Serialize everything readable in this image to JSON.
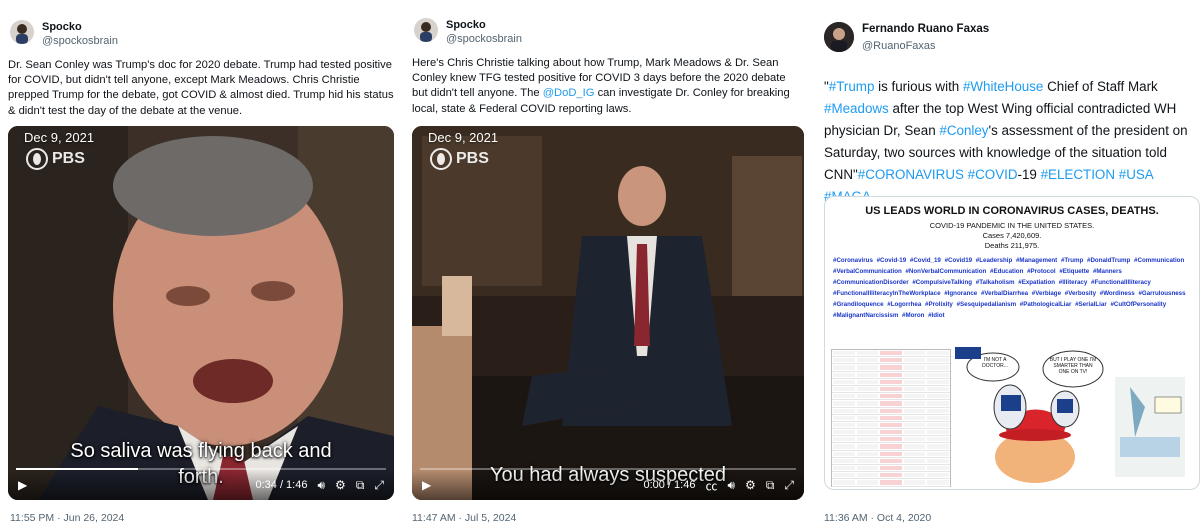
{
  "tweets": [
    {
      "author": "Spocko",
      "handle": "@spockosbrain",
      "text": "Dr. Sean Conley was Trump's doc for 2020 debate. Trump had tested positive for COVID, but didn't tell anyone, except Mark Meadows. Chris Christie prepped Trump for the debate, got COVID & almost died. Trump hid his status & didn't test the day of the debate at the venue.",
      "video": {
        "date_overlay": "Dec 9, 2021",
        "network": "PBS",
        "caption_line1": "So saliva was flying back and",
        "caption_line2": "forth.",
        "time": "0:34 / 1:46",
        "progress": 0.33
      },
      "timestamp": "11:55 PM · Jun 26, 2024"
    },
    {
      "author": "Spocko",
      "handle": "@spockosbrain",
      "text_before_link": "Here's Chris Christie talking about how Trump, Mark Meadows & Dr. Sean Conley knew TFG tested positive for COVID 3 days before the 2020 debate but didn't tell anyone. The ",
      "link": "@DoD_IG",
      "text_after_link": " can investigate Dr. Conley for breaking local, state & Federal COVID reporting laws.",
      "video": {
        "date_overlay": "Dec 9, 2021",
        "network": "PBS",
        "caption_line1": "You had always suspected",
        "time": "0:00 / 1:46",
        "progress": 0.0
      },
      "timestamp": "11:47 AM · Jul 5, 2024"
    },
    {
      "author": "Fernando Ruano Faxas",
      "handle": "@RuanoFaxas",
      "text_parts": [
        {
          "t": "\"",
          "hash": false
        },
        {
          "t": "#Trump",
          "hash": true
        },
        {
          "t": " is furious with ",
          "hash": false
        },
        {
          "t": "#WhiteHouse",
          "hash": true
        },
        {
          "t": " Chief of Staff Mark ",
          "hash": false
        },
        {
          "t": "#Meadows",
          "hash": true
        },
        {
          "t": " after the top West Wing official contradicted WH physician Dr, Sean ",
          "hash": false
        },
        {
          "t": "#Conley",
          "hash": true
        },
        {
          "t": "'s assessment of the president on Saturday, two sources with knowledge of the situation told CNN\"",
          "hash": false
        },
        {
          "t": "#CORONAVIRUS",
          "hash": true
        },
        {
          "t": " ",
          "hash": false
        },
        {
          "t": "#COVID",
          "hash": true
        },
        {
          "t": "-19 ",
          "hash": false
        },
        {
          "t": "#ELECTION",
          "hash": true
        },
        {
          "t": " ",
          "hash": false
        },
        {
          "t": "#USA",
          "hash": true
        },
        {
          "t": " ",
          "hash": false
        },
        {
          "t": "#MAGA",
          "hash": true
        }
      ],
      "image": {
        "title": "US LEADS WORLD IN CORONAVIRUS CASES, DEATHS.",
        "subtitle": "COVID-19 PANDEMIC IN THE UNITED STATES.",
        "cases": "Cases 7,420,609.",
        "deaths": "Deaths 211,975.",
        "hashtags": "#Coronavirus #Covid-19 #Covid_19 #Covid19 #Leadership #Management #Trump #DonaldTrump #Communication #VerbalCommunication #NonVerbalCommunication #Education #Protocol #Etiquette #Manners #CommunicationDisorder #CompulsiveTalking #Talkaholism #Expatiation #Illiteracy #FunctionalIlliteracy #FunctionalIlliteracyInTheWorkplace #Ignorance #VerbalDiarrhea #Verbiage #Verbosity #Wordiness #Garrulousness #Grandiloquence #Logorrhea #Prolixity #Sesquipedalianism #PathologicalLiar #SerialLiar #CultOfPersonality #MalignantNarcissism #Moron #Idiot",
        "cartoon_bubble1": "I'M NOT A DOCTOR...",
        "cartoon_bubble2": "BUT I PLAY ONE I'M SMARTER THAN ONE ON TV!"
      },
      "timestamp": "11:36 AM · Oct 4, 2020"
    }
  ]
}
